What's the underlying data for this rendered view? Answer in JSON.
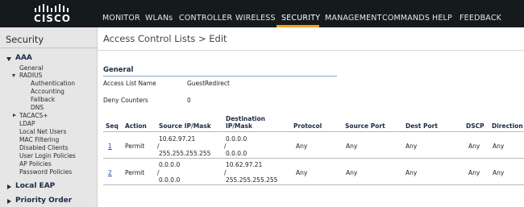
{
  "header": {
    "logo_text": "CISCO",
    "nav": [
      "MONITOR",
      "WLANs",
      "CONTROLLER",
      "WIRELESS",
      "SECURITY",
      "MANAGEMENT",
      "COMMANDS",
      "HELP",
      "FEEDBACK"
    ],
    "active": "SECURITY",
    "accent_color": "#f5a21b"
  },
  "sidebar": {
    "title": "Security",
    "aaa": "AAA",
    "general": "General",
    "radius": "RADIUS",
    "radius_items": [
      "Authentication",
      "Accounting",
      "Fallback",
      "DNS"
    ],
    "tacacs": "TACACS+",
    "items": [
      "LDAP",
      "Local Net Users",
      "MAC Filtering",
      "Disabled Clients",
      "User Login Policies",
      "AP Policies",
      "Password Policies"
    ],
    "local_eap": "Local EAP",
    "priority_order": "Priority Order"
  },
  "main": {
    "title": "Access Control Lists > Edit",
    "section": "General",
    "access_list_name_label": "Access List Name",
    "access_list_name_value": "GuestRedirect",
    "deny_counters_label": "Deny Counters",
    "deny_counters_value": "0",
    "columns": [
      "Seq",
      "Action",
      "Source IP/Mask",
      "Destination IP/Mask",
      "Protocol",
      "Source Port",
      "Dest Port",
      "DSCP",
      "Direction"
    ],
    "rows": [
      {
        "seq": "1",
        "action": "Permit",
        "src_ip": "10.62.97.21",
        "src_mask": "255.255.255.255",
        "dst_ip": "0.0.0.0",
        "dst_mask": "0.0.0.0",
        "protocol": "Any",
        "src_port": "Any",
        "dst_port": "Any",
        "dscp": "Any",
        "direction": "Any"
      },
      {
        "seq": "2",
        "action": "Permit",
        "src_ip": "0.0.0.0",
        "src_mask": "0.0.0.0",
        "dst_ip": "10.62.97.21",
        "dst_mask": "255.255.255.255",
        "protocol": "Any",
        "src_port": "Any",
        "dst_port": "Any",
        "dscp": "Any",
        "direction": "Any"
      }
    ]
  }
}
